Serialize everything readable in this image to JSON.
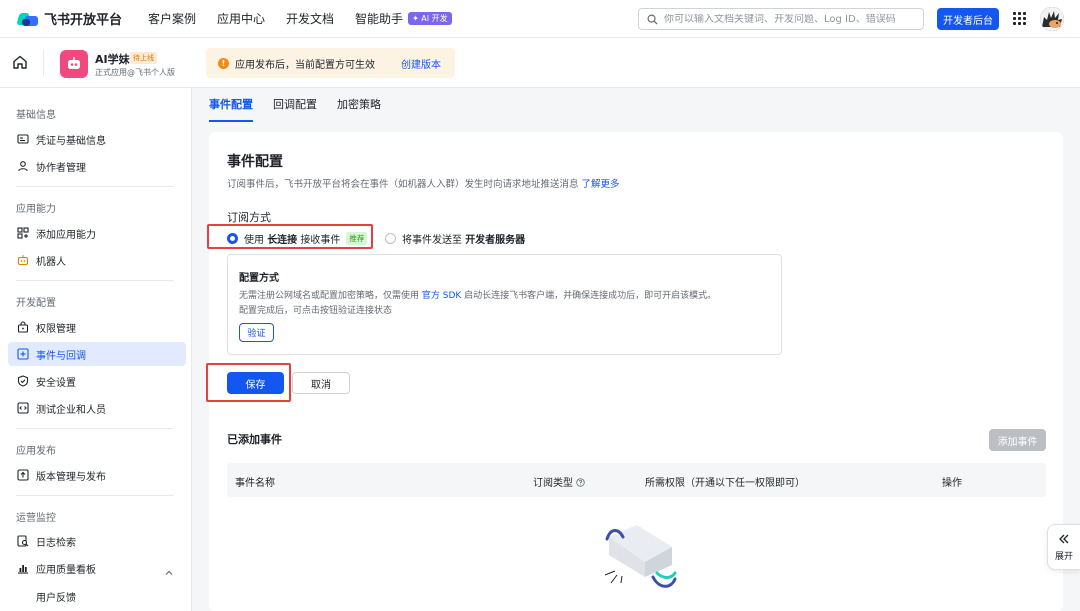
{
  "topnav": {
    "brand": "飞书开放平台",
    "links": [
      "客户案例",
      "应用中心",
      "开发文档",
      "智能助手"
    ],
    "ai_badge": "✦ AI 开发",
    "search_placeholder": "你可以输入文档关键词、开发问题、Log ID、错误码",
    "dev_console": "开发者后台",
    "colors": {
      "primary": "#1456f0"
    }
  },
  "appbar": {
    "app_name": "AI学妹",
    "status": "待上线",
    "subtitle": "正式应用@飞书个人版",
    "notice": "应用发布后，当前配置方可生效",
    "notice_link": "创建版本"
  },
  "sidebar": {
    "groups": [
      "基础信息",
      "应用能力",
      "开发配置",
      "应用发布",
      "运营监控"
    ],
    "items": [
      {
        "label": "凭证与基础信息",
        "icon": "credential-icon"
      },
      {
        "label": "协作者管理",
        "icon": "user-icon"
      },
      {
        "label": "添加应用能力",
        "icon": "grid-add-icon"
      },
      {
        "label": "机器人",
        "icon": "robot-icon"
      },
      {
        "label": "权限管理",
        "icon": "lock-icon"
      },
      {
        "label": "事件与回调",
        "icon": "event-icon",
        "active": true
      },
      {
        "label": "安全设置",
        "icon": "shield-icon"
      },
      {
        "label": "测试企业和人员",
        "icon": "code-icon"
      },
      {
        "label": "版本管理与发布",
        "icon": "upload-icon"
      },
      {
        "label": "日志检索",
        "icon": "log-search-icon"
      },
      {
        "label": "应用质量看板",
        "icon": "chart-icon"
      }
    ],
    "sub_items": [
      "用户反馈"
    ]
  },
  "tabs": [
    "事件配置",
    "回调配置",
    "加密策略"
  ],
  "main": {
    "title": "事件配置",
    "desc": "订阅事件后，飞书开放平台将会在事件（如机器人入群）发生时向请求地址推送消息",
    "desc_link": "了解更多",
    "subscribe_label": "订阅方式",
    "option1_pre": "使用",
    "option1_bold": "长连接",
    "option1_post": "接收事件",
    "option1_tag": "推荐",
    "option2_pre": "将事件发送至",
    "option2_bold": "开发者服务器",
    "config_title": "配置方式",
    "config_line1_pre": "无需注册公网域名或配置加密策略，仅需使用",
    "config_line1_link": "官方 SDK",
    "config_line1_post": "启动长连接飞书客户端，并确保连接成功后，即可开启该模式。",
    "config_line2": "配置完成后，可点击按钮验证连接状态",
    "verify": "验证",
    "save": "保存",
    "cancel": "取消",
    "added_title": "已添加事件",
    "add_event": "添加事件",
    "table_headers": [
      "事件名称",
      "订阅类型",
      "所需权限（开通以下任一权限即可）",
      "操作"
    ]
  },
  "expand": "展开"
}
